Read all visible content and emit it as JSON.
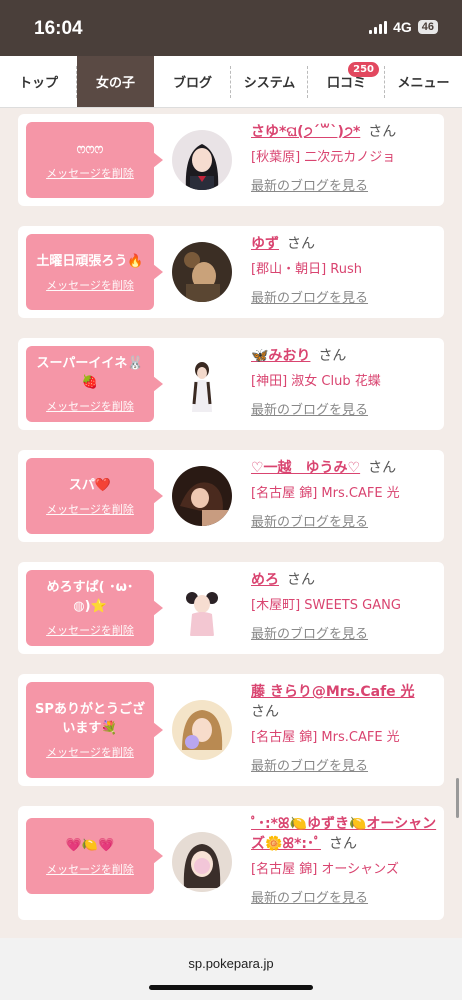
{
  "status_bar": {
    "time": "16:04",
    "network": "4G",
    "battery": "46"
  },
  "nav": {
    "tabs": [
      {
        "label": "トップ",
        "active": false
      },
      {
        "label": "女の子",
        "active": true
      },
      {
        "label": "ブログ",
        "active": false
      },
      {
        "label": "システム",
        "active": false
      },
      {
        "label": "口コミ",
        "active": false,
        "badge": "250"
      },
      {
        "label": "メニュー",
        "active": false
      }
    ]
  },
  "cards": [
    {
      "message": "ෆෆෆ",
      "delete_label": "メッセージを削除",
      "name": "さゆ*ଘ(੭ˊ꒳ˋ)੭*",
      "honorific": "さん",
      "shop": "[秋葉原] 二次元カノジョ",
      "blog_link": "最新のブログを見る",
      "avatar_icon": "girl-photo"
    },
    {
      "message": "土曜日頑張ろう🔥",
      "delete_label": "メッセージを削除",
      "name": "ゆず",
      "honorific": "さん",
      "shop": "[郡山・朝日] Rush",
      "blog_link": "最新のブログを見る",
      "avatar_icon": "girl-photo"
    },
    {
      "message": "スーパーイイネ🐰🍓",
      "delete_label": "メッセージを削除",
      "name": "🦋みおり",
      "honorific": "さん",
      "shop": "[神田] 淑女 Club 花蝶",
      "blog_link": "最新のブログを見る",
      "avatar_icon": "girl-photo"
    },
    {
      "message": "スパ❤️",
      "delete_label": "メッセージを削除",
      "name": "♡一越　ゆうみ♡",
      "honorific": "さん",
      "shop": "[名古屋 錦] Mrs.CAFE 光",
      "blog_link": "最新のブログを見る",
      "avatar_icon": "girl-photo"
    },
    {
      "message": "めろすぱ( ･ω･◍)⭐",
      "delete_label": "メッセージを削除",
      "name": "めろ",
      "honorific": "さん",
      "shop": "[木屋町] SWEETS GANG",
      "blog_link": "最新のブログを見る",
      "avatar_icon": "girl-photo"
    },
    {
      "message": "SPありがとうございます💐",
      "delete_label": "メッセージを削除",
      "name": "藤 きらり@Mrs.Cafe 光",
      "honorific": "さん",
      "shop": "[名古屋 錦] Mrs.CAFE 光",
      "blog_link": "最新のブログを見る",
      "avatar_icon": "girl-photo"
    },
    {
      "message": "💗🍋💗",
      "delete_label": "メッセージを削除",
      "name": "ﾟ･:*ꕤ🍋ゆずき🍋オーシャンズ🌼ꕤ*:･ﾟ",
      "honorific": "さん",
      "shop": "[名古屋 錦] オーシャンズ",
      "blog_link": "最新のブログを見る",
      "avatar_icon": "girl-photo"
    }
  ],
  "footer": {
    "url": "sp.pokepara.jp"
  },
  "colors": {
    "accent": "#d94470",
    "bubble": "#f596a7",
    "nav_active": "#5a4a44"
  }
}
